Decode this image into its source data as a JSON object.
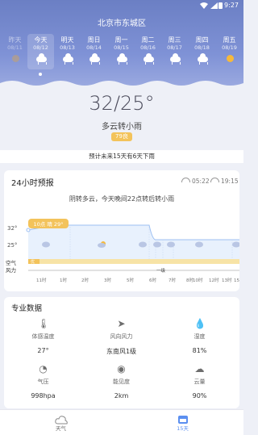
{
  "status_bar": {
    "time": "9:27"
  },
  "location": "北京市东城区",
  "days": [
    {
      "name": "昨天",
      "date": "08/11",
      "icon": "haze-icon"
    },
    {
      "name": "今天",
      "date": "08/12",
      "icon": "cloud-rain-icon"
    },
    {
      "name": "明天",
      "date": "08/13",
      "icon": "cloud-rain-icon"
    },
    {
      "name": "周日",
      "date": "08/14",
      "icon": "cloud-rain-icon"
    },
    {
      "name": "周一",
      "date": "08/15",
      "icon": "cloud-rain-icon"
    },
    {
      "name": "周二",
      "date": "08/16",
      "icon": "cloud-rain-icon"
    },
    {
      "name": "周三",
      "date": "08/17",
      "icon": "cloud-rain-icon"
    },
    {
      "name": "周四",
      "date": "08/18",
      "icon": "cloud-rain-icon"
    },
    {
      "name": "周五",
      "date": "08/19",
      "icon": "sun-icon"
    }
  ],
  "current": {
    "temp": "32/25°",
    "condition": "多云转小雨",
    "aqi": "79良"
  },
  "forecast_note": "预计未来15天有6天下雨",
  "hourly": {
    "title": "24小时预报",
    "sunrise": "05:22",
    "sunset": "19:15",
    "summary": "阴转多云，今天晚间22点转后转小雨",
    "tooltip": "10点 晴 29°",
    "temp_high": "32°",
    "temp_low": "25°",
    "row_label_air": "空气",
    "row_label_wind": "风力",
    "wind_value": "一级",
    "aqi_tag": "优",
    "times": [
      "11时",
      "1时",
      "2时",
      "3时",
      "5时",
      "6时",
      "7时",
      "8时",
      "10时",
      "12时",
      "13时",
      "15"
    ]
  },
  "pro": {
    "title": "专业数据",
    "metrics": [
      {
        "icon": "thermometer-icon",
        "label": "体感温度",
        "value": "27°"
      },
      {
        "icon": "wind-direction-icon",
        "label": "风向风力",
        "value": "东南风1级"
      },
      {
        "icon": "humidity-icon",
        "label": "湿度",
        "value": "81%"
      },
      {
        "icon": "pressure-icon",
        "label": "气压",
        "value": "998hpa"
      },
      {
        "icon": "visibility-icon",
        "label": "能见度",
        "value": "2km"
      },
      {
        "icon": "cloud-cover-icon",
        "label": "云量",
        "value": "90%"
      }
    ]
  },
  "nav": {
    "tab1": "天气",
    "tab2": "15天"
  },
  "colors": {
    "accent": "#5b8ff0",
    "tooltip": "#f3c35b",
    "aqi": "#f3c35b",
    "sky": "#7f92d6"
  }
}
